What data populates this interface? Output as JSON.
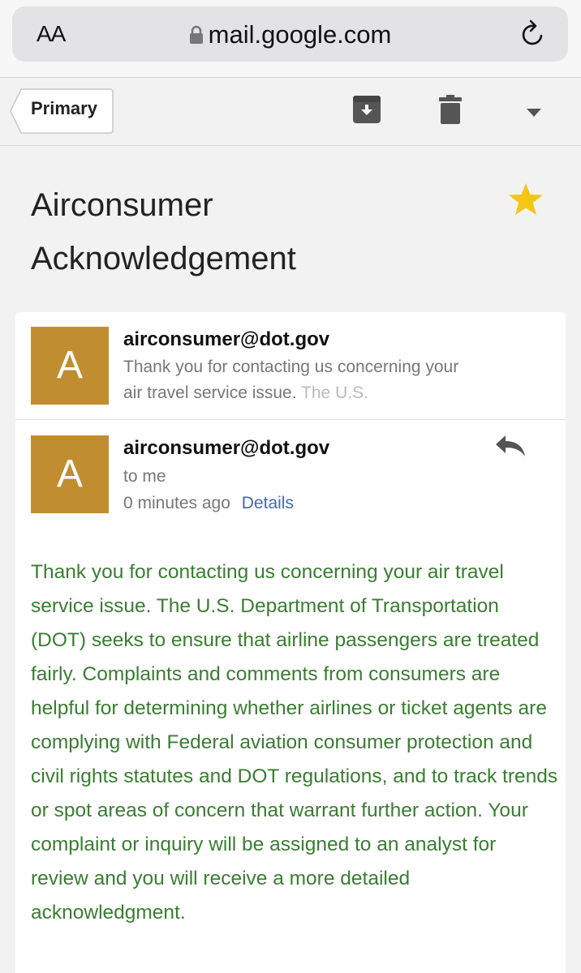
{
  "browser": {
    "text_size_label": "AA",
    "url": "mail.google.com"
  },
  "toolbar": {
    "back_label": "Primary"
  },
  "email": {
    "subject_line1": "Airconsumer",
    "subject_line2": "Acknowledgement",
    "collapsed_message": {
      "avatar_letter": "A",
      "sender": "airconsumer@dot.gov",
      "snippet": "Thank you for contacting us concerning your air travel service issue.",
      "snippet_fade": "The U.S."
    },
    "open_message": {
      "avatar_letter": "A",
      "sender": "airconsumer@dot.gov",
      "recipient": "to me",
      "time": "0 minutes ago",
      "details_label": "Details",
      "body": "Thank you for contacting us concerning your air travel service issue. The U.S. Department of Transportation (DOT) seeks to ensure that airline passengers are treated fairly. Complaints and comments from consumers are helpful for determining whether airlines or ticket agents are complying with Federal aviation consumer protection and civil rights statutes and DOT regulations, and to track trends or spot areas of concern that warrant further action. Your complaint or inquiry will be assigned to an analyst for review and you will receive a more detailed acknowledgment."
    }
  },
  "colors": {
    "avatar": "#c08e30",
    "body_text": "#3a7d32",
    "link": "#3d6bb5",
    "star": "#f5c518"
  }
}
